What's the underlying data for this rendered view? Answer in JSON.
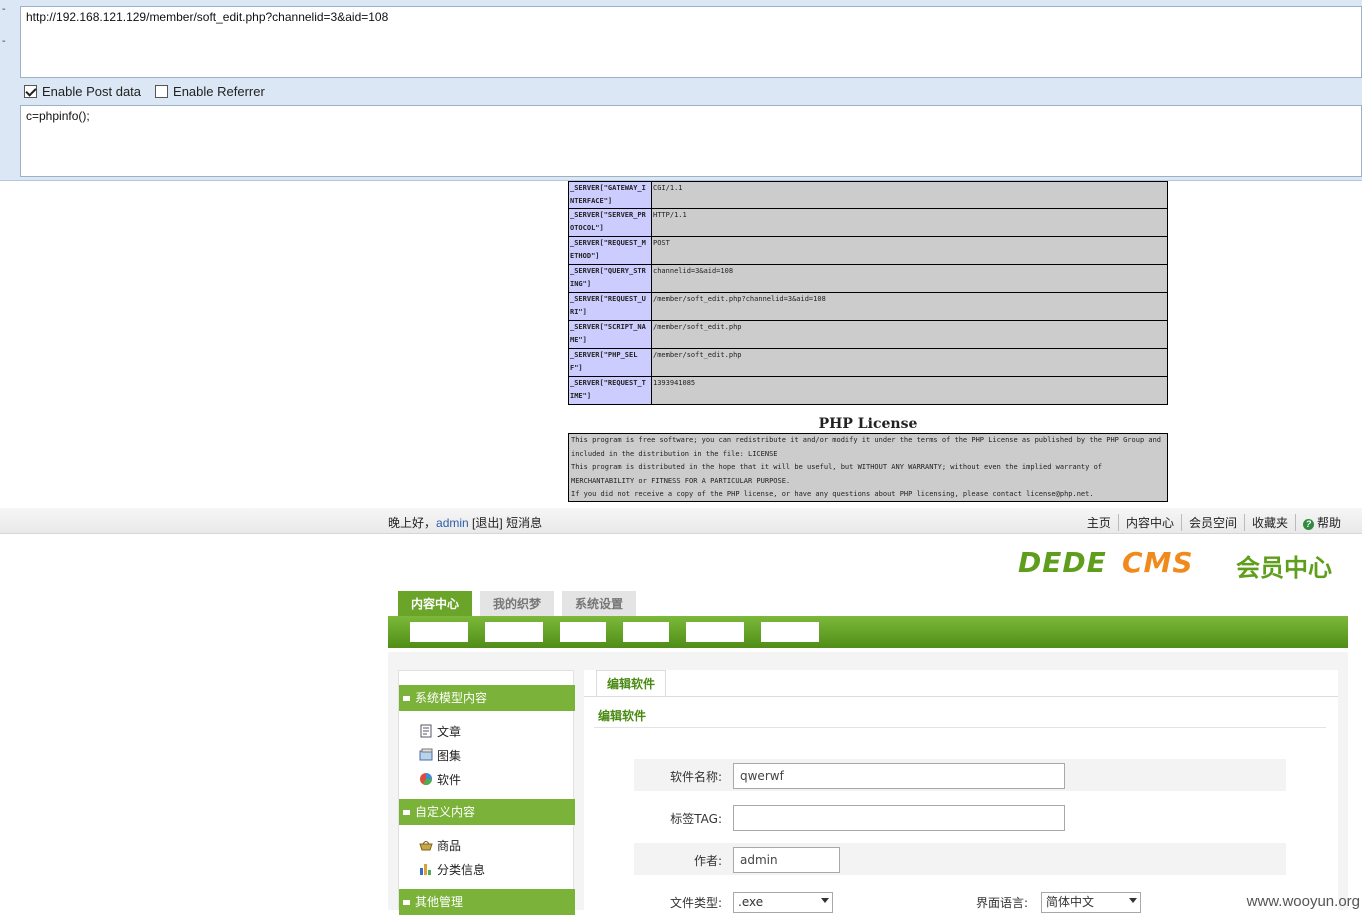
{
  "hackbar": {
    "edge_marks": [
      "-",
      "-"
    ],
    "url": "http://192.168.121.129/member/soft_edit.php?channelid=3&aid=108",
    "enable_post_label": "Enable Post data",
    "enable_post_checked": true,
    "enable_referrer_label": "Enable Referrer",
    "enable_referrer_checked": false,
    "post_data": "c=phpinfo();"
  },
  "phpinfo": {
    "rows": [
      {
        "key": "_SERVER[\"GATEWAY_INTERFACE\"]",
        "value": "CGI/1.1"
      },
      {
        "key": "_SERVER[\"SERVER_PROTOCOL\"]",
        "value": "HTTP/1.1"
      },
      {
        "key": "_SERVER[\"REQUEST_METHOD\"]",
        "value": "POST"
      },
      {
        "key": "_SERVER[\"QUERY_STRING\"]",
        "value": "channelid=3&aid=108"
      },
      {
        "key": "_SERVER[\"REQUEST_URI\"]",
        "value": "/member/soft_edit.php?channelid=3&aid=108"
      },
      {
        "key": "_SERVER[\"SCRIPT_NAME\"]",
        "value": "/member/soft_edit.php"
      },
      {
        "key": "_SERVER[\"PHP_SELF\"]",
        "value": "/member/soft_edit.php"
      },
      {
        "key": "_SERVER[\"REQUEST_TIME\"]",
        "value": "1393941085"
      }
    ],
    "license_title": "PHP License",
    "license_lines": [
      "This program is free software; you can redistribute it and/or modify it under the terms of the PHP License as published by the PHP Group and included in the distribution in the file: LICENSE",
      "This program is distributed in the hope that it will be useful, but WITHOUT ANY WARRANTY; without even the implied warranty of MERCHANTABILITY or FITNESS FOR A PARTICULAR PURPOSE.",
      "If you did not receive a copy of the PHP license, or have any questions about PHP licensing, please contact license@php.net."
    ]
  },
  "topbar": {
    "greeting": "晚上好，",
    "username": "admin",
    "logout": "[退出]",
    "messages": "短消息",
    "links": [
      "主页",
      "内容中心",
      "会员空间",
      "收藏夹"
    ],
    "help": "帮助"
  },
  "logo": {
    "dede": "DEDE",
    "cms": "CMS",
    "center": "会员中心"
  },
  "nav": {
    "tabs": [
      "内容中心",
      "我的织梦",
      "系统设置"
    ],
    "active_tab": "内容中心"
  },
  "sidebar": {
    "sections": [
      {
        "title": "系统模型内容",
        "items": [
          {
            "label": "文章",
            "icon": "article-icon"
          },
          {
            "label": "图集",
            "icon": "album-icon"
          },
          {
            "label": "软件",
            "icon": "software-icon"
          }
        ]
      },
      {
        "title": "自定义内容",
        "items": [
          {
            "label": "商品",
            "icon": "basket-icon"
          },
          {
            "label": "分类信息",
            "icon": "chart-icon"
          }
        ]
      },
      {
        "title": "其他管理",
        "items": []
      }
    ]
  },
  "form": {
    "tab": "编辑软件",
    "section_title": "编辑软件",
    "name_label": "软件名称:",
    "name_value": "qwerwf",
    "tag_label": "标签TAG:",
    "tag_value": "",
    "author_label": "作者:",
    "author_value": "admin",
    "filetype_label": "文件类型:",
    "filetype_value": ".exe",
    "lang_label": "界面语言:",
    "lang_value": "简体中文"
  },
  "watermark": "www.wooyun.org",
  "colors": {
    "dede_green": "#6aa52a",
    "cms_orange": "#f08a1c",
    "phpinfo_key_bg": "#ccccff",
    "phpinfo_value_bg": "#cccccc"
  }
}
